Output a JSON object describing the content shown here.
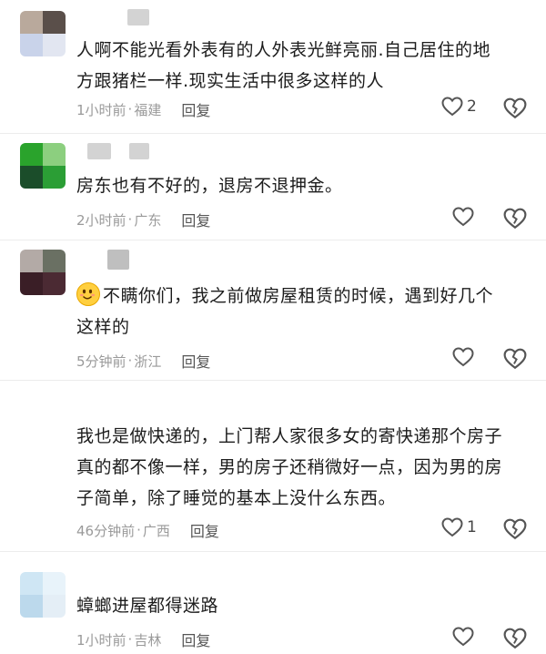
{
  "comments": [
    {
      "text": "人啊不能光看外表有的人外表光鲜亮丽.自己居住的地方跟猪栏一样.现实生活中很多这样的人",
      "line1": "人啊不能光看外表有的人外表光鲜亮丽.自己居住的地",
      "line2": "方跟猪栏一样.现实生活中很多这样的人",
      "time": "1小时前",
      "location": "福建",
      "reply": "回复",
      "likes": "2"
    },
    {
      "line1": "房东也有不好的，退房不退押金。",
      "time": "2小时前",
      "location": "广东",
      "reply": "回复",
      "likes": ""
    },
    {
      "line1": "不瞒你们，我之前做房屋租赁的时候，遇到好几个",
      "line2": "这样的",
      "emoji": "smiling-face-emoji",
      "time": "5分钟前",
      "location": "浙江",
      "reply": "回复",
      "likes": ""
    },
    {
      "line1": "我也是做快递的，上门帮人家很多女的寄快递那个房子",
      "line2": "真的都不像一样，男的房子还稍微好一点，因为男的房",
      "line3": "子简单，除了睡觉的基本上没什么东西。",
      "time": "46分钟前",
      "location": "广西",
      "reply": "回复",
      "likes": "1"
    },
    {
      "line1": "蟑螂进屋都得迷路",
      "time": "1小时前",
      "location": "吉林",
      "reply": "回复",
      "likes": ""
    }
  ],
  "separator": "·",
  "icons": {
    "like": "heart-outline-icon",
    "dislike": "broken-heart-outline-icon"
  },
  "colors": {
    "meta": "#9a9a9a",
    "text": "#1c1c1c",
    "icon": "#555555"
  }
}
